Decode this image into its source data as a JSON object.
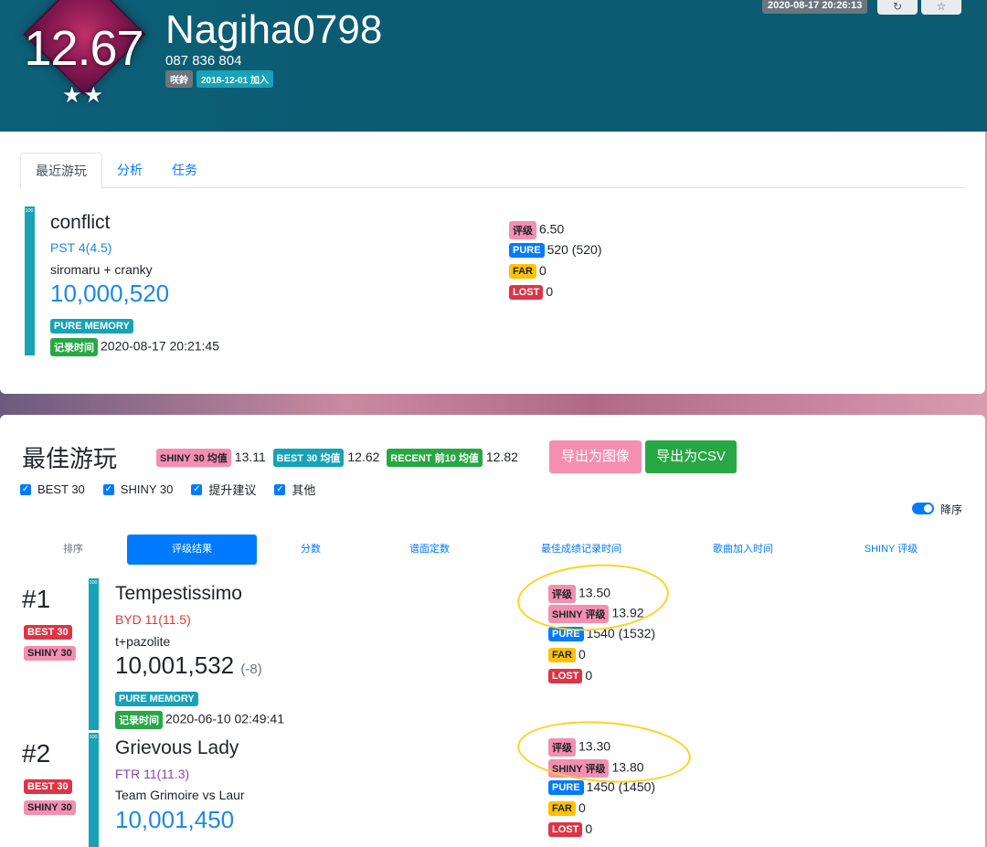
{
  "header": {
    "rating": "12.67",
    "stars": "★★",
    "username": "Nagiha0798",
    "user_code": "087 836 804",
    "tag": "咲鈴",
    "joined": "2018-12-01 加入",
    "timestamp": "2020-08-17 20:26:13",
    "btn1_icon": "↻",
    "btn2_icon": "☆"
  },
  "recent": {
    "tabs": [
      "最近游玩",
      "分析",
      "任务"
    ],
    "bar_label": "100",
    "title": "conflict",
    "difficulty": "PST 4(4.5)",
    "difficulty_color": "#1e88e5",
    "artist": "siromaru + cranky",
    "score": "10,000,520",
    "clear_type": "PURE MEMORY",
    "time_label": "记录时间",
    "time": "2020-08-17 20:21:45",
    "rating_label": "评级",
    "rating": "6.50",
    "pure_label": "PURE",
    "pure": "520 (520)",
    "far_label": "FAR",
    "far": "0",
    "lost_label": "LOST",
    "lost": "0"
  },
  "best": {
    "title": "最佳游玩",
    "shiny_avg_label": "SHINY 30 均值",
    "shiny_avg": "13.11",
    "best_avg_label": "BEST 30 均值",
    "best_avg": "12.62",
    "recent_avg_label": "RECENT 前10 均值",
    "recent_avg": "12.82",
    "export_image": "导出为图像",
    "export_csv": "导出为CSV",
    "checkboxes": [
      "BEST 30",
      "SHINY 30",
      "提升建议",
      "其他"
    ],
    "order_label": "降序",
    "sort_tabs": [
      "排序",
      "评级结果",
      "分数",
      "谱面定数",
      "最佳成绩记录时间",
      "歌曲加入时间",
      "SHINY 评级"
    ],
    "entries": [
      {
        "rank": "#1",
        "badge1": "BEST 30",
        "badge2": "SHINY 30",
        "bar_label": "100",
        "title": "Tempestissimo",
        "difficulty": "BYD 11(11.5)",
        "difficulty_color": "#e53935",
        "artist": "t+pazolite",
        "score": "10,001,532",
        "score_delta": "(-8)",
        "clear_type": "PURE MEMORY",
        "time_label": "记录时间",
        "time": "2020-06-10 02:49:41",
        "rating_label": "评级",
        "rating": "13.50",
        "shiny_label": "SHINY 评级",
        "shiny": "13.92",
        "pure_label": "PURE",
        "pure": "1540 (1532)",
        "far_label": "FAR",
        "far": "0",
        "lost_label": "LOST",
        "lost": "0"
      },
      {
        "rank": "#2",
        "badge1": "BEST 30",
        "badge2": "SHINY 30",
        "bar_label": "100",
        "title": "Grievous Lady",
        "difficulty": "FTR 11(11.3)",
        "difficulty_color": "#8e44ad",
        "artist": "Team Grimoire vs Laur",
        "score": "10,001,450",
        "rating_label": "评级",
        "rating": "13.30",
        "shiny_label": "SHINY 评级",
        "shiny": "13.80",
        "pure_label": "PURE",
        "pure": "1450 (1450)",
        "far_label": "FAR",
        "far": "0",
        "lost_label": "LOST",
        "lost": "0"
      }
    ]
  }
}
